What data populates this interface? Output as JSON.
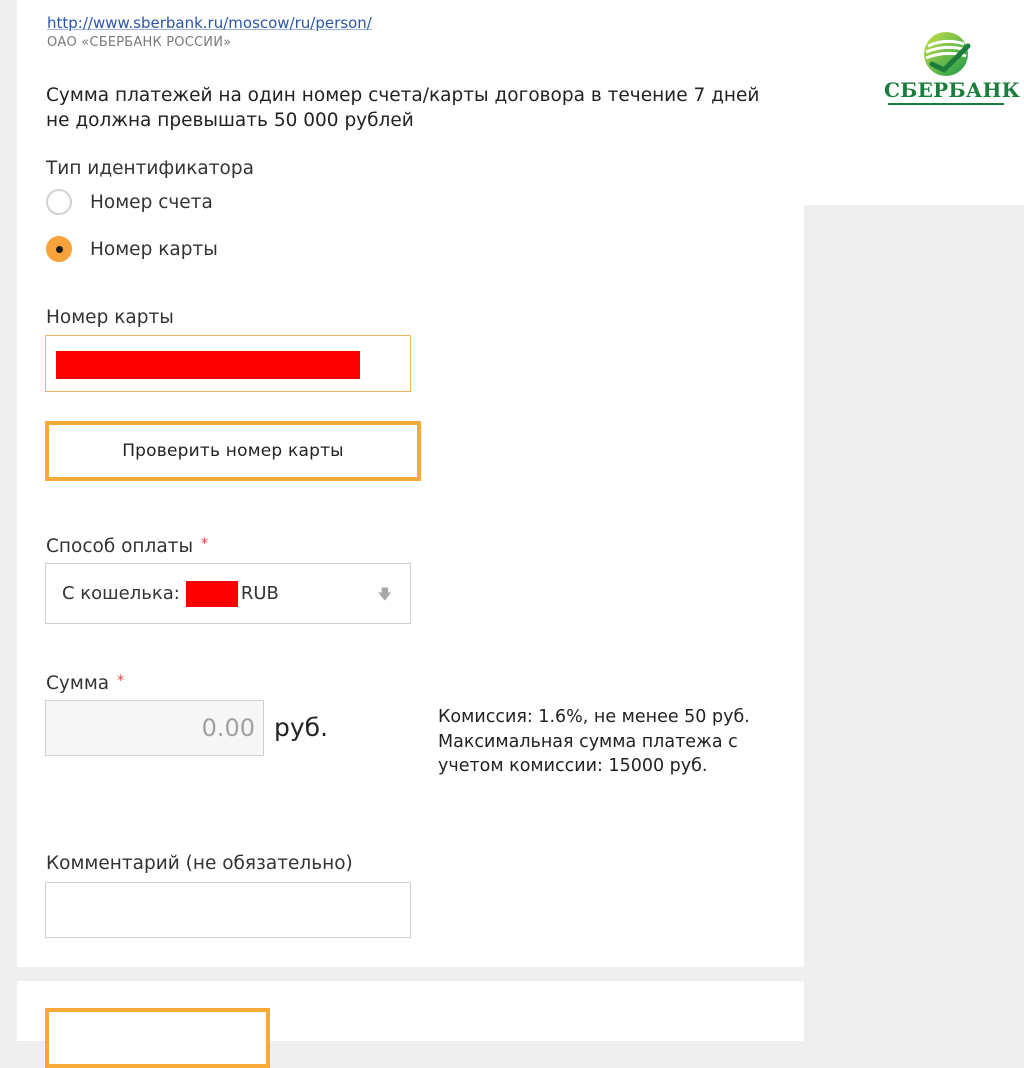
{
  "header": {
    "url": "http://www.sberbank.ru/moscow/ru/person/",
    "org": "ОАО «СБЕРБАНК РОССИИ»",
    "logo_text": "СБЕРБАНК"
  },
  "notice": "Сумма платежей на один номер счета/карты договора в течение 7 дней не должна превышать 50 000 рублей",
  "identifier": {
    "label": "Тип идентификатора",
    "options": [
      {
        "label": "Номер счета",
        "checked": false
      },
      {
        "label": "Номер карты",
        "checked": true
      }
    ]
  },
  "card": {
    "label": "Номер карты",
    "check_button": "Проверить номер карты"
  },
  "payment_method": {
    "label": "Способ оплаты",
    "required_mark": "*",
    "value_prefix": "С кошелька:",
    "value_suffix": "RUB"
  },
  "amount": {
    "label": "Сумма",
    "required_mark": "*",
    "placeholder": "0.00",
    "currency": "руб.",
    "fee_line1": "Комиссия: 1.6%, не менее 50 руб.",
    "fee_line2": "Максимальная сумма платежа с учетом комиссии: 15000 руб."
  },
  "comment": {
    "label": "Комментарий (не обязательно)"
  },
  "colors": {
    "accent": "#f7a93a",
    "brand_green": "#1a7d3c",
    "link": "#2a56a8"
  }
}
